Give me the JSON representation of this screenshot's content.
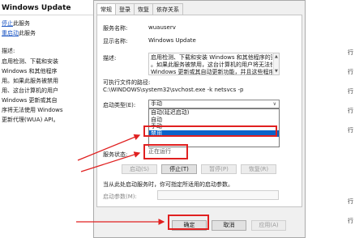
{
  "background": {
    "title": "Windows Update",
    "stop_link": "停止",
    "stop_suffix": "此服务",
    "restart_link": "重启动",
    "restart_suffix": "此服务",
    "desc_label": "描述:",
    "desc_lines": [
      "启用检测、下载和安装",
      "Windows 和其他程序",
      "用。如果此服务被禁用",
      "用、这台计算机的用户",
      "Windows 更新或其自",
      "序将无法使用 Windows",
      "更新代理(WUA) API。"
    ]
  },
  "right_strip": {
    "rows": [
      "行",
      "行",
      "行",
      "行",
      "行",
      "行",
      "行"
    ]
  },
  "dialog": {
    "tabs": [
      "常规",
      "登录",
      "恢复",
      "依存关系"
    ],
    "service_name_label": "服务名称:",
    "service_name_value": "wuauserv",
    "display_name_label": "显示名称:",
    "display_name_value": "Windows Update",
    "description_label": "描述:",
    "description_lines": [
      "启用检测、下载和安装 Windows 和其他程序的更新",
      "。如果此服务被禁用，这台计算机的用户将无法使用",
      "Windows 更新或其自动更新功能，并且这些程序将"
    ],
    "exe_path_label": "可执行文件的路径:",
    "exe_path_value": "C:\\WINDOWS\\system32\\svchost.exe -k netsvcs -p",
    "startup_type_label": "启动类型(E):",
    "startup_type_value": "手动",
    "startup_options": [
      "自动(延迟启动)",
      "自动",
      "手动",
      "禁用"
    ],
    "startup_selected_index": 3,
    "status_label": "服务状态:",
    "status_value": "正在运行",
    "buttons": {
      "start": "启动(S)",
      "stop": "停止(T)",
      "pause": "暂停(P)",
      "resume": "恢复(R)"
    },
    "hint_text": "当从此处启动服务时，你可指定所适用的启动参数。",
    "param_label": "启动参数(M):",
    "param_value": "",
    "ok_button": "确定",
    "cancel_button": "取消",
    "apply_button": "应用(A)"
  },
  "annotations": {
    "highlight_color": "#e02020"
  }
}
